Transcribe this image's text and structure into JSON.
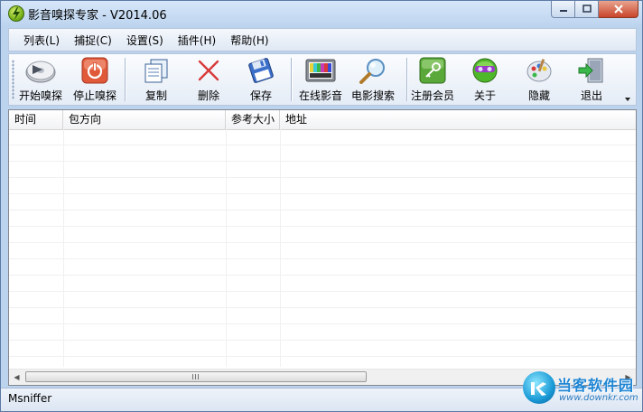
{
  "window": {
    "title": "影音嗅探专家 - V2014.06"
  },
  "menu": [
    {
      "label": "列表(L)"
    },
    {
      "label": "捕捉(C)"
    },
    {
      "label": "设置(S)"
    },
    {
      "label": "插件(H)"
    },
    {
      "label": "帮助(H)"
    }
  ],
  "toolbar": {
    "start": {
      "label": "开始嗅探",
      "icon": "sniff-disc-icon"
    },
    "stop": {
      "label": "停止嗅探",
      "icon": "power-icon",
      "color": "#e05a3a"
    },
    "copy": {
      "label": "复制",
      "icon": "copy-icon"
    },
    "delete": {
      "label": "删除",
      "icon": "delete-x-icon",
      "color": "#d83a3a"
    },
    "save": {
      "label": "保存",
      "icon": "floppy-icon"
    },
    "online": {
      "label": "在线影音",
      "icon": "tv-icon"
    },
    "search": {
      "label": "电影搜索",
      "icon": "magnifier-icon"
    },
    "register": {
      "label": "注册会员",
      "icon": "key-icon",
      "color": "#5aa83a"
    },
    "about": {
      "label": "关于",
      "icon": "globe-icon"
    },
    "hide": {
      "label": "隐藏",
      "icon": "palette-icon"
    },
    "exit": {
      "label": "退出",
      "icon": "exit-door-icon"
    }
  },
  "list": {
    "columns": [
      {
        "label": "时间"
      },
      {
        "label": "包方向"
      },
      {
        "label": "参考大小"
      },
      {
        "label": "地址"
      }
    ],
    "rows": []
  },
  "status": {
    "text": "Msniffer"
  },
  "watermark": {
    "title": "当客软件园",
    "url": "www.downkr.com"
  }
}
